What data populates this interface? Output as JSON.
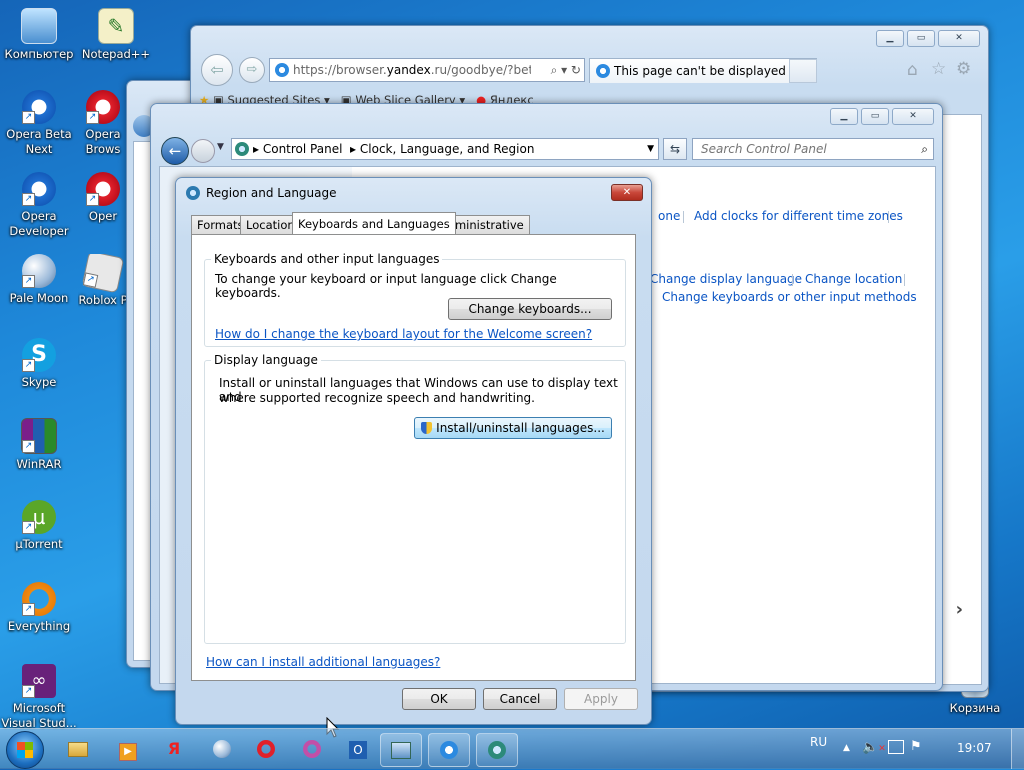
{
  "desktop": {
    "icons": [
      {
        "label": "Компьютер",
        "glyph": "🖥"
      },
      {
        "label": "Notepad++",
        "glyph": "✎"
      },
      {
        "label": "Opera Beta Next",
        "glyph": "O"
      },
      {
        "label": "Opera Brows",
        "glyph": "O"
      },
      {
        "label": "Opera Developer",
        "glyph": "O"
      },
      {
        "label": "Oper",
        "glyph": "O"
      },
      {
        "label": "Pale Moon",
        "glyph": "☾"
      },
      {
        "label": "Roblox P",
        "glyph": "▣"
      },
      {
        "label": "Skype",
        "glyph": "S"
      },
      {
        "label": "WinRAR",
        "glyph": "▤"
      },
      {
        "label": "µTorrent",
        "glyph": "µ"
      },
      {
        "label": "Everything",
        "glyph": "◎"
      },
      {
        "label": "Microsoft Visual Stud...",
        "glyph": "∞"
      },
      {
        "label": "Корзина",
        "glyph": "🗑"
      }
    ]
  },
  "browser": {
    "url_prefix": "https://browser.",
    "url_bold": "yandex",
    "url_rest": ".ru/goodbye/?beta=0",
    "tab_title": "This page can't be displayed",
    "favorites": {
      "suggested": "Suggested Sites",
      "webslice": "Web Slice Gallery",
      "yandex": "Яндекс"
    }
  },
  "control_panel": {
    "breadcrumb": [
      "Control Panel",
      "Clock, Language, and Region"
    ],
    "search_placeholder": "Search Control Panel",
    "links": {
      "zone_partial": "one",
      "add_clocks": "Add clocks for different time zones",
      "change_display_language": "Change display language",
      "change_location": "Change location",
      "change_keyboards": "Change keyboards or other input methods"
    }
  },
  "dialog": {
    "title": "Region and Language",
    "tabs": [
      "Formats",
      "Location",
      "Keyboards and Languages",
      "Administrative"
    ],
    "active_tab": "Keyboards and Languages",
    "keyboards_group": {
      "title": "Keyboards and other input languages",
      "text": "To change your keyboard or input language click Change keyboards.",
      "button": "Change keyboards...",
      "link": "How do I change the keyboard layout for the Welcome screen?"
    },
    "display_group": {
      "title": "Display language",
      "text1": "Install or uninstall languages that Windows can use to display text and",
      "text2": "where supported recognize speech and handwriting.",
      "button": "Install/uninstall languages..."
    },
    "bottom_link": "How can I install additional languages?",
    "buttons": {
      "ok": "OK",
      "cancel": "Cancel",
      "apply": "Apply"
    }
  },
  "taskbar": {
    "lang": "RU",
    "time": "19:07"
  },
  "colors": {
    "link": "#0b55c4",
    "desktop": "#1e88d9",
    "close_red": "#c9473a"
  }
}
